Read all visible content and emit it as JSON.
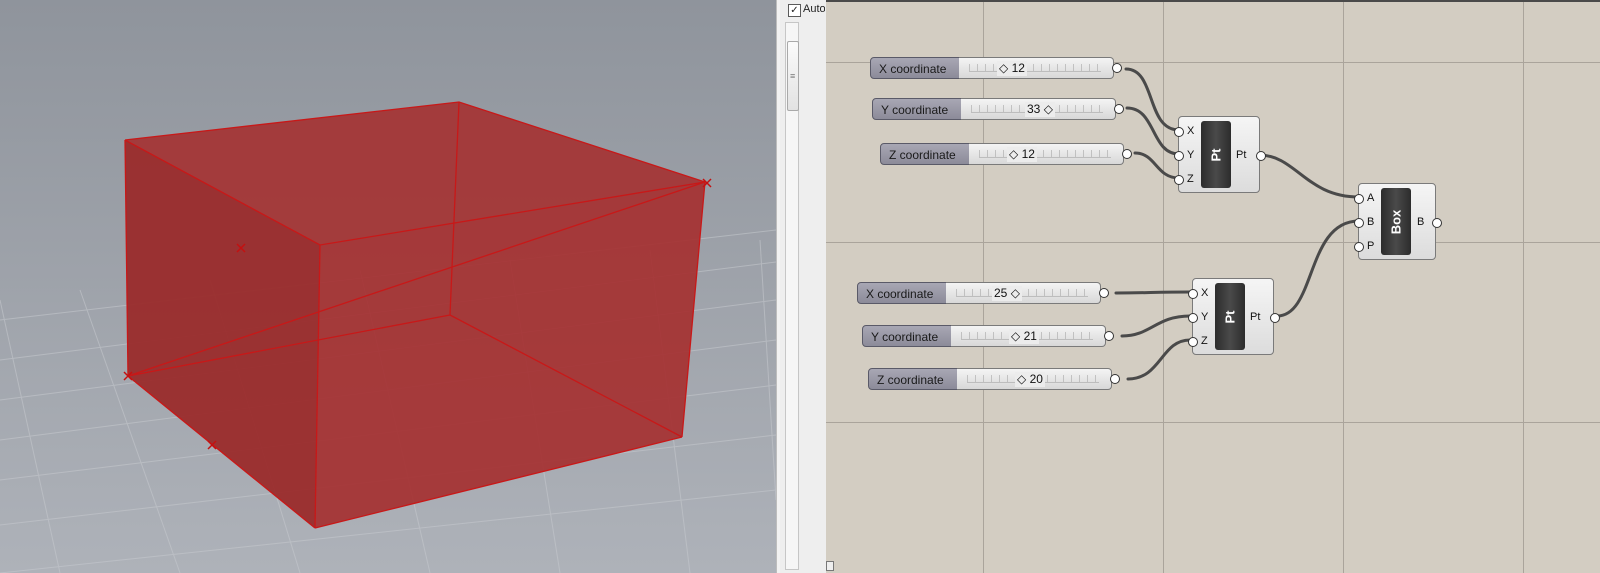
{
  "side_panel": {
    "auto_label": "Auto",
    "auto_checked": "✓"
  },
  "sliders": [
    {
      "label": "X coordinate",
      "value": "12"
    },
    {
      "label": "Y coordinate",
      "value": "33"
    },
    {
      "label": "Z coordinate",
      "value": "12"
    },
    {
      "label": "X coordinate",
      "value": "25"
    },
    {
      "label": "Y coordinate",
      "value": "21"
    },
    {
      "label": "Z coordinate",
      "value": "20"
    }
  ],
  "point_components": [
    {
      "name": "Pt",
      "inputs": [
        "X",
        "Y",
        "Z"
      ],
      "output": "Pt"
    },
    {
      "name": "Pt",
      "inputs": [
        "X",
        "Y",
        "Z"
      ],
      "output": "Pt"
    }
  ],
  "box_component": {
    "name": "Box",
    "inputs": [
      "A",
      "B",
      "P"
    ],
    "output": "B"
  },
  "colors": {
    "box_fill": "#a03030",
    "box_edge": "#c81818",
    "viewport_bg": "#9ba0a8",
    "canvas_bg": "#d3cdc2"
  }
}
